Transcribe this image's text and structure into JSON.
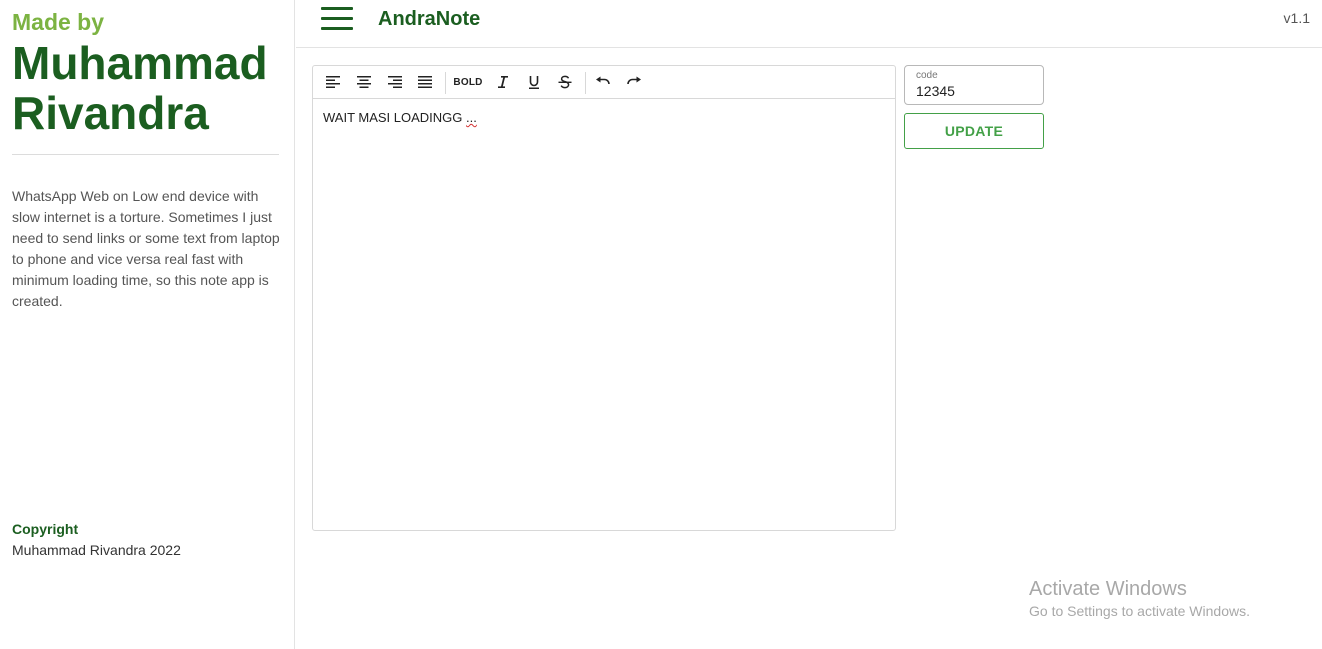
{
  "sidebar": {
    "made_by": "Made by",
    "author": "Muhammad Rivandra",
    "description": "WhatsApp Web on Low end device with slow internet is a torture. Sometimes I just need to send links or some text from laptop to phone and vice versa real fast with minimum loading time, so this note app is created.",
    "copyright_label": "Copyright",
    "copyright_text": "Muhammad Rivandra 2022"
  },
  "header": {
    "menu_icon": "hamburger-menu-icon",
    "app_title": "AndraNote",
    "version": "v1.1"
  },
  "editor": {
    "toolbar": {
      "align_left_icon": "align-left-icon",
      "align_center_icon": "align-center-icon",
      "align_right_icon": "align-right-icon",
      "align_justify_icon": "align-justify-icon",
      "bold_label": "BOLD",
      "italic_icon": "italic-icon",
      "underline_icon": "underline-icon",
      "strikethrough_icon": "strikethrough-icon",
      "undo_icon": "undo-icon",
      "redo_icon": "redo-icon"
    },
    "content_main": "WAIT MASI LOADINGG ",
    "content_squiggle": "..."
  },
  "code_field": {
    "label": "code",
    "value": "12345"
  },
  "update_button": {
    "label": "UPDATE"
  },
  "watermark": {
    "title": "Activate Windows",
    "subtitle": "Go to Settings to activate Windows."
  },
  "colors": {
    "brand_dark": "#1b5e20",
    "brand_light": "#7cb342",
    "button_green": "#43a047"
  }
}
